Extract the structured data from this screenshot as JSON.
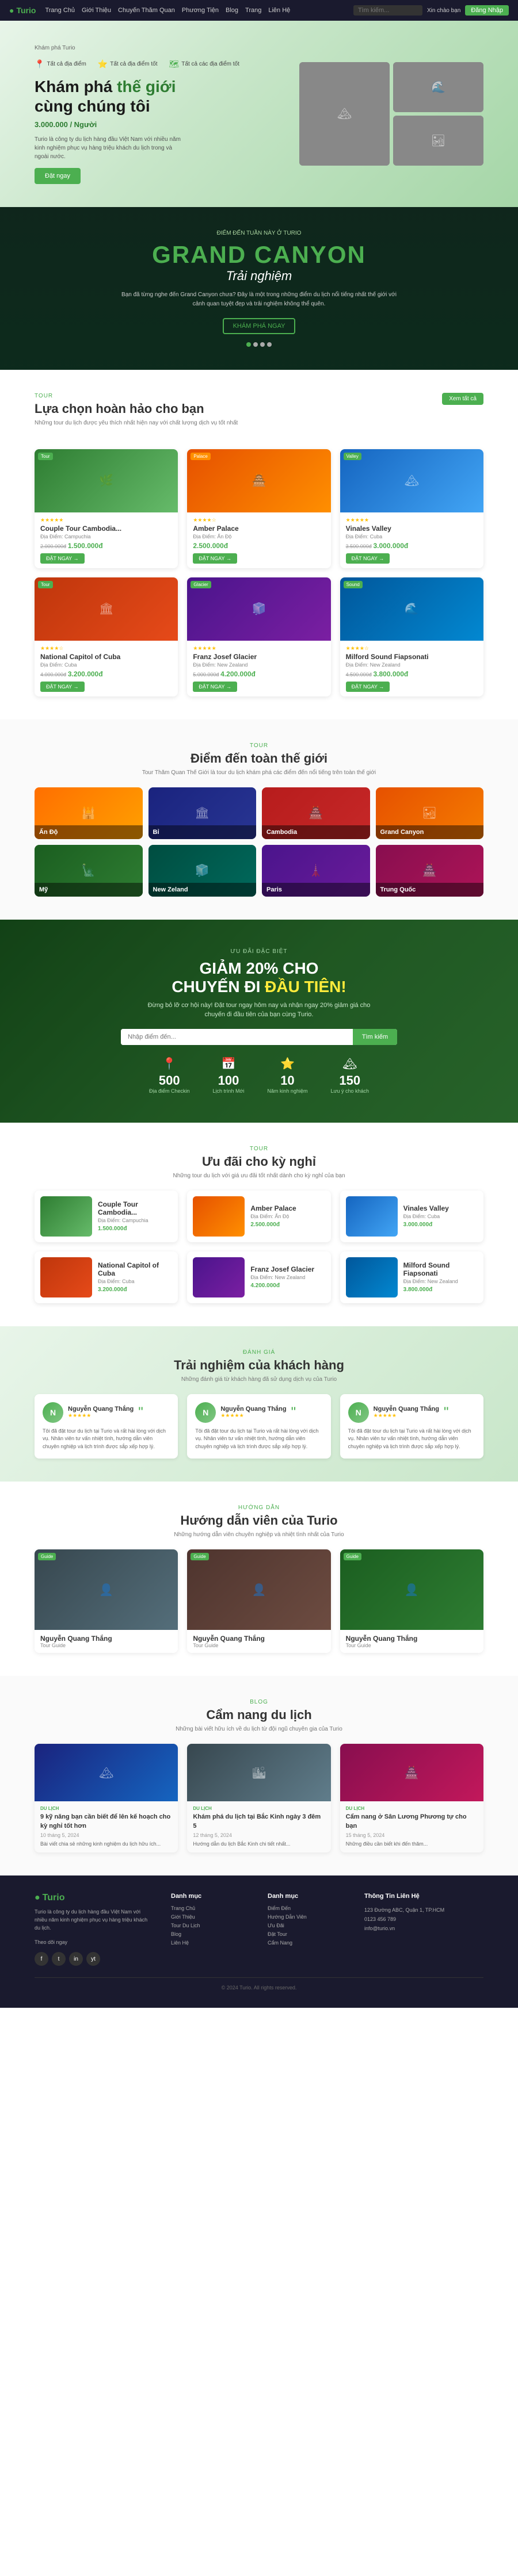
{
  "nav": {
    "logo": "Turio",
    "logo_dot": "●",
    "links": [
      "Trang Chủ",
      "Giới Thiệu",
      "Chuyến Thăm Quan",
      "Phương Tiện",
      "Blog",
      "Trang",
      "Liên Hệ"
    ],
    "search_placeholder": "Tìm kiếm...",
    "user_info": "Xin chào bạn",
    "login_btn": "Đăng Nhập"
  },
  "hero": {
    "label": "Khám phá Turio",
    "stat1": "Tất cả địa điểm",
    "stat2": "Tất cả địa điểm tốt",
    "stat3": "Tất cả các địa điểm tốt",
    "title_line1": "Khám phá",
    "title_highlight": "thế giới",
    "title_line2": "cùng chúng tôi",
    "subtitle": "3.000.000 / Người",
    "description": "Turio là công ty du lịch hàng đầu Việt Nam với nhiều năm kinh nghiệm phục vụ hàng triệu khách du lịch trong và ngoài nước.",
    "cta": "Đặt ngay"
  },
  "grand_canyon": {
    "label": "ĐIỂM ĐẾN TUẦN NÀY Ở TURIO",
    "title": "GRAND CANYON",
    "subtitle": "Trải nghiệm",
    "description": "Bạn đã từng nghe đến Grand Canyon chưa? Đây là một trong những điểm du lịch nổi tiếng nhất thế giới với cảnh quan tuyệt đẹp và trải nghiệm không thể quên.",
    "cta": "KHÁM PHÁ NGAY"
  },
  "featured": {
    "label": "Tour",
    "title": "Lựa chọn hoàn hảo cho bạn",
    "description": "Những tour du lịch được yêu thích nhất hiện nay với chất lượng dịch vụ tốt nhất",
    "view_all": "Xem tất cả",
    "cards": [
      {
        "id": 1,
        "badge": "Tour",
        "stars": "★★★★★",
        "title": "Couple Tour Cambodia...",
        "location": "Địa Điểm: Campuchia",
        "old_price": "2.000.000đ",
        "price": "1.500.000đ",
        "btn": "ĐẶT NGAY →"
      },
      {
        "id": 2,
        "badge": "Palace",
        "stars": "★★★★☆",
        "title": "Amber Palace",
        "location": "Địa Điểm: Ấn Độ",
        "old_price": "",
        "price": "2.500.000đ",
        "btn": "ĐẶT NGAY →"
      },
      {
        "id": 3,
        "badge": "Valley",
        "stars": "★★★★★",
        "title": "Vinales Valley",
        "location": "Địa Điểm: Cuba",
        "old_price": "3.500.000đ",
        "price": "3.000.000đ",
        "btn": "ĐẶT NGAY →"
      },
      {
        "id": 4,
        "badge": "Tour",
        "stars": "★★★★☆",
        "title": "National Capitol of Cuba",
        "location": "Địa Điểm: Cuba",
        "old_price": "4.000.000đ",
        "price": "3.200.000đ",
        "btn": "ĐẶT NGAY →"
      },
      {
        "id": 5,
        "badge": "Glacier",
        "stars": "★★★★★",
        "title": "Franz Josef Glacier",
        "location": "Địa Điểm: New Zealand",
        "old_price": "5.000.000đ",
        "price": "4.200.000đ",
        "btn": "ĐẶT NGAY →"
      },
      {
        "id": 6,
        "badge": "Sound",
        "stars": "★★★★☆",
        "title": "Milford Sound Fiapsonati",
        "location": "Địa Điểm: New Zealand",
        "old_price": "4.500.000đ",
        "price": "3.800.000đ",
        "btn": "ĐẶT NGAY →"
      }
    ]
  },
  "destinations": {
    "label": "Tour",
    "title": "Điểm đến toàn thế giới",
    "description": "Tour Thăm Quan Thế Giới là tour du lịch khám phá các điểm đến nổi tiếng trên toàn thế giới",
    "items": [
      {
        "name": "Ấn Độ"
      },
      {
        "name": "Bỉ"
      },
      {
        "name": "Cambodia"
      },
      {
        "name": "Grand Canyon"
      },
      {
        "name": "Mỹ"
      },
      {
        "name": "New Zeland"
      },
      {
        "name": "Paris"
      },
      {
        "name": "Trung Quốc"
      }
    ]
  },
  "promo": {
    "label": "Ưu đãi đặc biệt",
    "title1": "GIẢM 20% CHO",
    "title2": "CHUYẾN ĐI",
    "title_highlight": "ĐẦU TIÊN!",
    "description": "Đừng bỏ lỡ cơ hội này! Đặt tour ngay hôm nay và nhận ngay 20% giảm giá cho chuyến đi đầu tiên của bạn cùng Turio.",
    "search_placeholder": "Nhập điểm đến...",
    "search_btn": "Tìm kiếm",
    "stats": [
      {
        "num": "500",
        "label": "Địa điểm Checkin",
        "icon": "📍"
      },
      {
        "num": "100",
        "label": "Lịch trình Mới",
        "icon": "📅"
      },
      {
        "num": "10",
        "label": "Năm kinh nghiệm",
        "icon": "⭐"
      },
      {
        "num": "150",
        "label": "Lưu ý cho khách",
        "icon": "🏔"
      }
    ]
  },
  "holiday": {
    "label": "Tour",
    "title": "Ưu đãi cho kỳ nghỉ",
    "description": "Những tour du lịch với giá ưu đãi tốt nhất dành cho kỳ nghỉ của bạn",
    "cards": [
      {
        "id": 1,
        "title": "Couple Tour Cambodia...",
        "location": "Địa Điểm: Campuchia",
        "price": "1.500.000đ"
      },
      {
        "id": 2,
        "title": "Amber Palace",
        "location": "Địa Điểm: Ấn Độ",
        "price": "2.500.000đ"
      },
      {
        "id": 3,
        "title": "Vinales Valley",
        "location": "Địa Điểm: Cuba",
        "price": "3.000.000đ"
      },
      {
        "id": 4,
        "title": "National Capitol of Cuba",
        "location": "Địa Điểm: Cuba",
        "price": "3.200.000đ"
      },
      {
        "id": 5,
        "title": "Franz Josef Glacier",
        "location": "Địa Điểm: New Zealand",
        "price": "4.200.000đ"
      },
      {
        "id": 6,
        "title": "Milford Sound Fiapsonati",
        "location": "Địa Điểm: New Zealand",
        "price": "3.800.000đ"
      }
    ]
  },
  "testimonials": {
    "label": "Đánh giá",
    "title": "Trải nghiệm của khách hàng",
    "description": "Những đánh giá từ khách hàng đã sử dụng dịch vụ của Turio",
    "items": [
      {
        "name": "Nguyễn Quang Thắng",
        "stars": "★★★★★",
        "text": "Tôi đã đặt tour du lịch tại Turio và rất hài lòng với dịch vụ. Nhân viên tư vấn nhiệt tình, hướng dẫn viên chuyên nghiệp và lịch trình được sắp xếp hợp lý.",
        "avatar": "N"
      },
      {
        "name": "Nguyễn Quang Thắng",
        "stars": "★★★★★",
        "text": "Tôi đã đặt tour du lịch tại Turio và rất hài lòng với dịch vụ. Nhân viên tư vấn nhiệt tình, hướng dẫn viên chuyên nghiệp và lịch trình được sắp xếp hợp lý.",
        "avatar": "N"
      },
      {
        "name": "Nguyễn Quang Thắng",
        "stars": "★★★★★",
        "text": "Tôi đã đặt tour du lịch tại Turio và rất hài lòng với dịch vụ. Nhân viên tư vấn nhiệt tình, hướng dẫn viên chuyên nghiệp và lịch trình được sắp xếp hợp lý.",
        "avatar": "N"
      }
    ]
  },
  "guides": {
    "label": "Hướng dẫn",
    "title": "Hướng dẫn viên của Turio",
    "description": "Những hướng dẫn viên chuyên nghiệp và nhiệt tình nhất của Turio",
    "items": [
      {
        "id": 1,
        "name": "Nguyễn Quang Thắng",
        "role": "Tour Guide",
        "badge": "Guide"
      },
      {
        "id": 2,
        "name": "Nguyễn Quang Thắng",
        "role": "Tour Guide",
        "badge": "Guide"
      },
      {
        "id": 3,
        "name": "Nguyễn Quang Thắng",
        "role": "Tour Guide",
        "badge": "Guide"
      }
    ]
  },
  "blog": {
    "label": "Blog",
    "title": "Cẩm nang du lịch",
    "description": "Những bài viết hữu ích về du lịch từ đội ngũ chuyên gia của Turio",
    "items": [
      {
        "id": 1,
        "category": "Du lịch",
        "title": "9 kỹ năng bạn cần biết để lên kế hoạch cho kỳ nghỉ tốt hơn",
        "date": "10 tháng 5, 2024",
        "excerpt": "Bài viết chia sẻ những kinh nghiệm du lịch hữu ích..."
      },
      {
        "id": 2,
        "category": "Du lịch",
        "title": "Khám phá du lịch tại Bắc Kinh ngày 3 đêm 5",
        "date": "12 tháng 5, 2024",
        "excerpt": "Hướng dẫn du lịch Bắc Kinh chi tiết nhất..."
      },
      {
        "id": 3,
        "category": "Du lịch",
        "title": "Cẩm nang ở Sân Lương Phương tự cho bạn",
        "date": "15 tháng 5, 2024",
        "excerpt": "Những điều cần biết khi đến thăm..."
      }
    ]
  },
  "footer": {
    "logo": "Turio",
    "logo_dot": "●",
    "description": "Turio là công ty du lịch hàng đầu Việt Nam với nhiều năm kinh nghiệm phục vụ hàng triệu khách du lịch.",
    "social": [
      "f",
      "t",
      "in",
      "yt"
    ],
    "menu1_title": "Danh mục",
    "menu1": [
      "Trang Chủ",
      "Giới Thiệu",
      "Tour Du Lịch",
      "Blog",
      "Liên Hệ"
    ],
    "menu2_title": "Danh mục",
    "menu2": [
      "Điểm Đến",
      "Hướng Dẫn Viên",
      "Ưu Đãi",
      "Đặt Tour",
      "Cẩm Nang"
    ],
    "contact_title": "Thông Tin Liên Hệ",
    "contact_address": "123 Đường ABC, Quận 1, TP.HCM",
    "contact_phone": "0123 456 789",
    "contact_email": "info@turio.vn",
    "copyright": "© 2024 Turio. All rights reserved.",
    "follow_label": "Theo dõi ngay"
  }
}
